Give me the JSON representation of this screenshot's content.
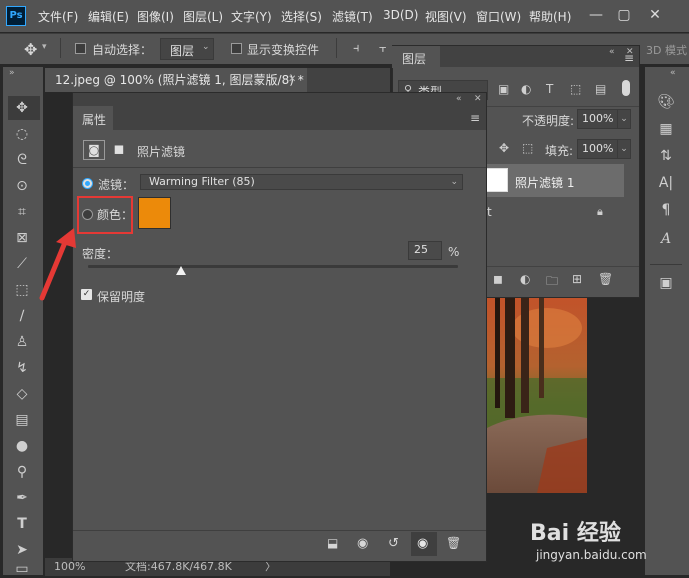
{
  "app": {
    "logo": "Ps"
  },
  "menu": [
    "文件(F)",
    "编辑(E)",
    "图像(I)",
    "图层(L)",
    "文字(Y)",
    "选择(S)",
    "滤镜(T)",
    "3D(D)",
    "视图(V)",
    "窗口(W)",
    "帮助(H)"
  ],
  "window_controls": {
    "minimize": "—",
    "maximize": "▢",
    "close": "✕"
  },
  "options_bar": {
    "auto_select_label": "自动选择：",
    "auto_select_value": "图层",
    "show_transform_label": "显示变换控件",
    "mode_3d": "3D 模式"
  },
  "document": {
    "tab_title": "12.jpeg @ 100% (照片滤镜 1, 图层蒙版/8) *",
    "close_glyph": "✕",
    "zoom": "100%",
    "doc_info": "文档:467.8K/467.8K",
    "arrow": "〉"
  },
  "layers_panel": {
    "title": "图层",
    "kind_label": "类型",
    "opacity_label": "不透明度:",
    "opacity_value": "100%",
    "fill_label": "填充:",
    "fill_value": "100%",
    "layer_name": "照片滤镜 1",
    "background_partial": "t"
  },
  "properties_panel": {
    "title": "属性",
    "adjustment_name": "照片滤镜",
    "filter_label": "滤镜：",
    "filter_value": "Warming Filter (85)",
    "color_label": "颜色：",
    "color_swatch": "#ec8a0a",
    "density_label": "密度：",
    "density_value": "25",
    "density_unit": "%",
    "density_fraction": 0.25,
    "preserve_label": "保留明度",
    "preserve_checked": true
  },
  "colors": {
    "highlight_box": "#e53935",
    "arrow": "#e53935",
    "accent_blue": "#31a8ff"
  },
  "watermark": {
    "brand": "Bai 经验",
    "url": "jingyan.baidu.com"
  }
}
